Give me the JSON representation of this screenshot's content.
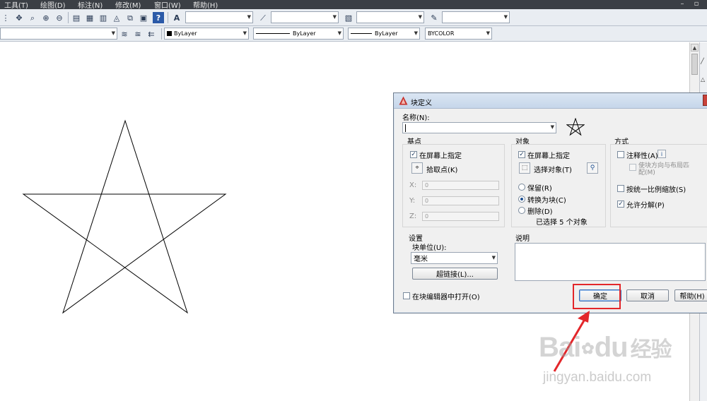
{
  "menu": {
    "items": [
      "工具(T)",
      "绘图(D)",
      "标注(N)",
      "修改(M)",
      "窗口(W)",
      "帮助(H)"
    ],
    "window_controls": [
      "–",
      "▫"
    ]
  },
  "toolbar2": {
    "color_value": "ByLayer",
    "linetype_value": "ByLayer",
    "lineweight_value": "ByLayer",
    "plotstyle_value": "BYCOLOR"
  },
  "dialog": {
    "title": "块定义",
    "name_label": "名称(N):",
    "name_value": "",
    "base_point": {
      "group_label": "基点",
      "specify_on_screen": "在屏幕上指定",
      "specify_checked": true,
      "pick_point": "拾取点(K)",
      "x_label": "X:",
      "x_value": "0",
      "y_label": "Y:",
      "y_value": "0",
      "z_label": "Z:",
      "z_value": "0"
    },
    "objects": {
      "group_label": "对象",
      "specify_on_screen": "在屏幕上指定",
      "specify_checked": true,
      "select_objects": "选择对象(T)",
      "retain": "保留(R)",
      "convert_to_block": "转换为块(C)",
      "delete": "删除(D)",
      "selected_count": "已选择 5 个对象"
    },
    "behavior": {
      "group_label": "方式",
      "annotative": "注释性(A)",
      "match_orientation": "使块方向与布局匹配(M)",
      "scale_uniformly": "按统一比例缩放(S)",
      "allow_exploding": "允许分解(P)",
      "allow_exploding_checked": true
    },
    "settings": {
      "group_label": "设置",
      "block_unit_label": "块单位(U):",
      "block_unit_value": "毫米",
      "hyperlink": "超链接(L)..."
    },
    "description_label": "说明",
    "open_in_editor": "在块编辑器中打开(O)",
    "buttons": {
      "ok": "确定",
      "cancel": "取消",
      "help": "帮助(H)"
    }
  },
  "watermark": {
    "brand_a": "Bai",
    "brand_b": "du",
    "brand_c": "经验",
    "url": "jingyan.baidu.com"
  },
  "colors": {
    "menubar": "#3b3f45",
    "toolbar": "#e9edf2",
    "dialog_bg": "#f0f0f0",
    "highlight": "#e3262a"
  }
}
